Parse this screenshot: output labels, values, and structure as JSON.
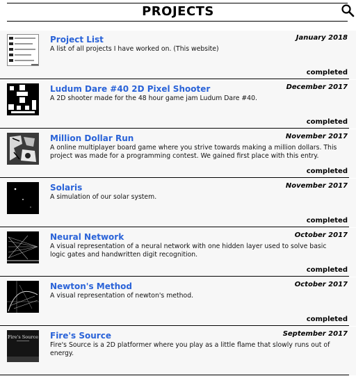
{
  "header": {
    "title": "PROJECTS",
    "search_icon": "search-icon"
  },
  "projects": [
    {
      "title": "Project List",
      "date": "January 2018",
      "description": "A list of all projects I have worked on. (This website)",
      "status": "completed"
    },
    {
      "title": "Ludum Dare #40 2D Pixel Shooter",
      "date": "December 2017",
      "description": "A 2D shooter made for the 48 hour game jam Ludum Dare #40.",
      "status": "completed"
    },
    {
      "title": "Million Dollar Run",
      "date": "November 2017",
      "description": "A online multiplayer board game where you strive towards making a million dollars. This project was made for a programming contest. We gained first place with this entry.",
      "status": "completed"
    },
    {
      "title": "Solaris",
      "date": "November 2017",
      "description": "A simulation of our solar system.",
      "status": "completed"
    },
    {
      "title": "Neural Network",
      "date": "October 2017",
      "description": "A visual representation of a neural network with one hidden layer used to solve basic logic gates and handwritten digit recognition.",
      "status": "completed"
    },
    {
      "title": "Newton's Method",
      "date": "October 2017",
      "description": "A visual representation of newton's method.",
      "status": "completed"
    },
    {
      "title": "Fire's Source",
      "date": "September 2017",
      "description": "Fire's Source is a 2D platformer where you play as a little flame that slowly runs out of energy.",
      "status": "",
      "thumb_caption": "Fire's Source"
    }
  ]
}
